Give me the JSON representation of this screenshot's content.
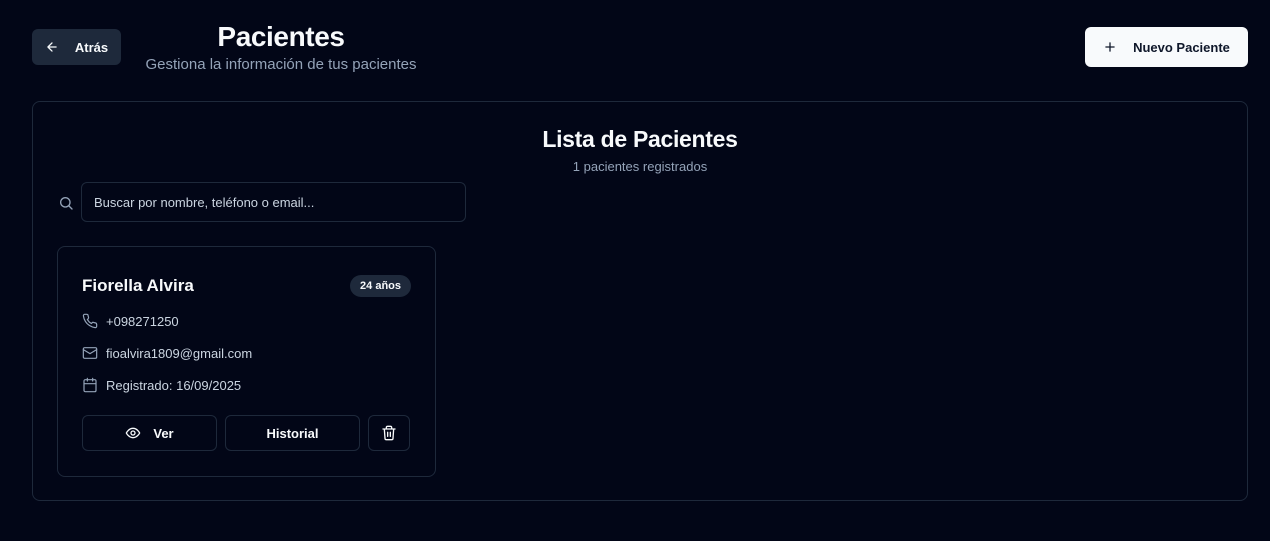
{
  "header": {
    "back_label": "Atrás",
    "title": "Pacientes",
    "subtitle": "Gestiona la información de tus pacientes",
    "new_label": "Nuevo Paciente"
  },
  "list": {
    "title": "Lista de Pacientes",
    "count_text": "1 pacientes registrados",
    "search_placeholder": "Buscar por nombre, teléfono o email...",
    "search_value": ""
  },
  "patients": [
    {
      "name": "Fiorella Alvira",
      "age": "24 años",
      "phone": "+098271250",
      "email": "fioalvira1809@gmail.com",
      "registered": "Registrado: 16/09/2025",
      "view_label": "Ver",
      "history_label": "Historial"
    }
  ],
  "icons": {
    "back": "arrow-left-icon",
    "new": "plus-icon",
    "search": "search-icon",
    "phone": "phone-icon",
    "email": "mail-icon",
    "date": "calendar-icon",
    "view": "eye-icon",
    "delete": "trash-icon"
  },
  "colors": {
    "background": "#020617",
    "border": "#1e293b",
    "muted_text": "#94a3b8",
    "primary_button": "#f8fafc"
  }
}
